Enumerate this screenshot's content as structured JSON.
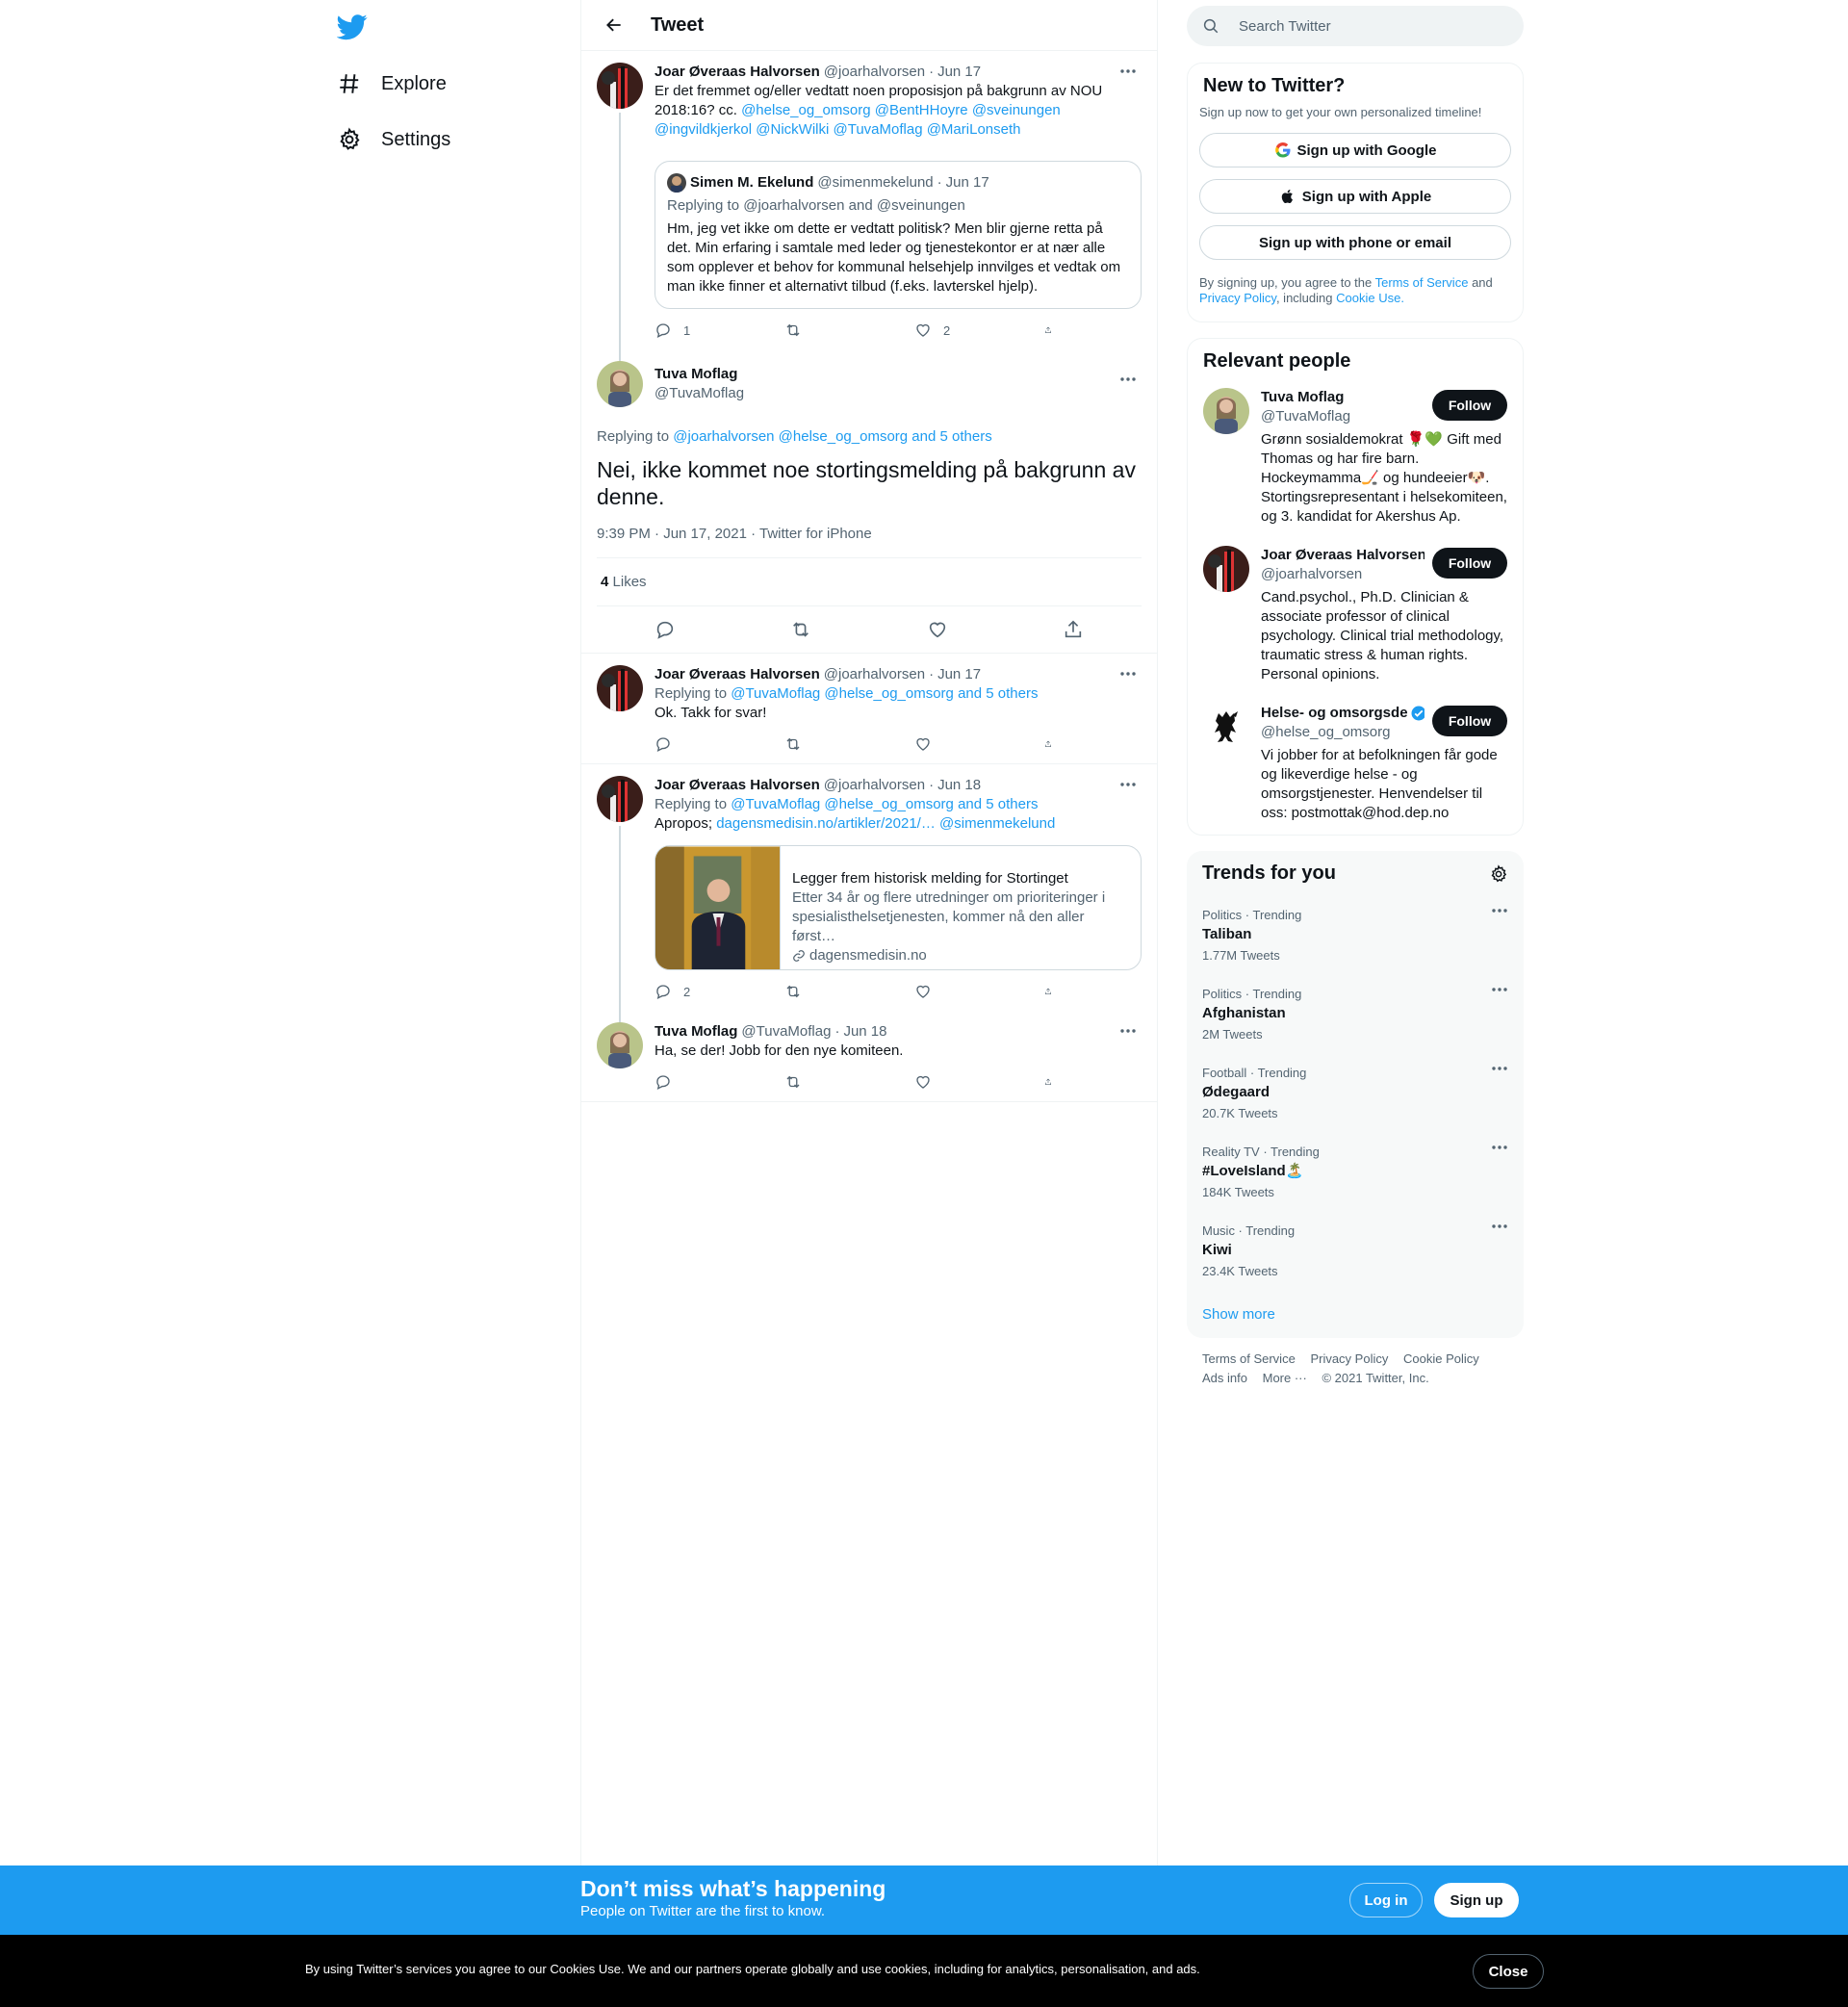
{
  "nav": {
    "items": [
      {
        "label": "Explore",
        "icon": "hashtag-icon"
      },
      {
        "label": "Settings",
        "icon": "gear-icon"
      }
    ]
  },
  "header": {
    "title": "Tweet"
  },
  "parent_tweet": {
    "name": "Joar Øveraas Halvorsen",
    "handle": "@joarhalvorsen",
    "date": "Jun 17",
    "text_plain": "Er det fremmet og/eller vedtatt noen proposisjon på bakgrunn av NOU 2018:16? cc.",
    "mentions_1": "@helse_og_omsorg @BentHHoyre @sveinungen @ingvildkjerkol",
    "mentions_2": "@NickWilki @TuvaMoflag @MariLonseth",
    "quote": {
      "name": "Simen M. Ekelund",
      "handle": "@simenmekelund",
      "date": "Jun 17",
      "replying": "Replying to @joarhalvorsen and @sveinungen",
      "text": "Hm, jeg vet ikke om dette er vedtatt politisk? Men blir gjerne retta på det. Min erfaring i samtale med leder og tjenestekontor er at nær alle som opplever et behov for kommunal helsehjelp innvilges et vedtak om man ikke finner et alternativt tilbud (f.eks. lavterskel hjelp)."
    },
    "replies": "1",
    "retweets": "",
    "likes": "2"
  },
  "focal_tweet": {
    "name": "Tuva Moflag",
    "handle": "@TuvaMoflag",
    "replying_prefix": "Replying to",
    "replying_links": "@joarhalvorsen @helse_og_omsorg and 5 others",
    "text": "Nei, ikke kommet noe stortingsmelding på bakgrunn av denne.",
    "timestamp": "9:39 PM · Jun 17, 2021 · Twitter for iPhone",
    "likes_count": "4",
    "likes_label": "Likes"
  },
  "replies": [
    {
      "name": "Joar Øveraas Halvorsen",
      "handle": "@joarhalvorsen",
      "date": "Jun 17",
      "replying_prefix": "Replying to",
      "replying_links": "@TuvaMoflag @helse_og_omsorg and 5 others",
      "text": "Ok. Takk for svar!",
      "replies": ""
    },
    {
      "name": "Joar Øveraas Halvorsen",
      "handle": "@joarhalvorsen",
      "date": "Jun 18",
      "replying_prefix": "Replying to",
      "replying_links": "@TuvaMoflag @helse_og_omsorg and 5 others",
      "text_prefix": "Apropos;",
      "link": "dagensmedisin.no/artikler/2021/…",
      "mention": "@simenmekelund",
      "card": {
        "title": "Legger frem historisk melding for Stortinget",
        "description": "Etter 34 år og flere utredninger om prioriteringer i spesialisthelsetjenesten, kommer nå den aller først…",
        "site": "dagensmedisin.no"
      },
      "replies": "2"
    },
    {
      "name": "Tuva Moflag",
      "handle": "@TuvaMoflag",
      "date": "Jun 18",
      "text": "Ha, se der! Jobb for den nye komiteen.",
      "replies": ""
    }
  ],
  "search": {
    "placeholder": "Search Twitter"
  },
  "signup_panel": {
    "title": "New to Twitter?",
    "subtitle": "Sign up now to get your own personalized timeline!",
    "google": "Sign up with Google",
    "apple": "Sign up with Apple",
    "phone": "Sign up with phone or email",
    "legal_1": "By signing up, you agree to the",
    "terms": "Terms of Service",
    "legal_and": "and",
    "privacy": "Privacy Policy",
    "legal_including": ", including",
    "cookie": "Cookie Use."
  },
  "relevant_people": {
    "title": "Relevant people",
    "follow_label": "Follow",
    "people": [
      {
        "name": "Tuva Moflag",
        "handle": "@TuvaMoflag",
        "bio": "Grønn sosialdemokrat 🌹💚 Gift med Thomas og har fire barn. Hockeymamma🏒 og hundeeier🐶. Stortingsrepresentant i helsekomiteen, og 3. kandidat for Akershus Ap."
      },
      {
        "name": "Joar Øveraas Halvorsen",
        "handle": "@joarhalvorsen",
        "bio": "Cand.psychol., Ph.D. Clinician & associate professor of clinical psychology. Clinical trial methodology, traumatic stress & human rights. Personal opinions."
      },
      {
        "name": "Helse- og omsorgsde",
        "handle": "@helse_og_omsorg",
        "bio": "Vi jobber for at befolkningen får gode og likeverdige helse - og omsorgstjenester. Henvendelser til oss: postmottak@hod.dep.no"
      }
    ]
  },
  "trends": {
    "title": "Trends for you",
    "items": [
      {
        "context": "Politics · Trending",
        "name": "Taliban",
        "count": "1.77M Tweets"
      },
      {
        "context": "Politics · Trending",
        "name": "Afghanistan",
        "count": "2M Tweets"
      },
      {
        "context": "Football · Trending",
        "name": "Ødegaard",
        "count": "20.7K Tweets"
      },
      {
        "context": "Reality TV · Trending",
        "name": "#LoveIsland🏝️",
        "count": "184K Tweets"
      },
      {
        "context": "Music · Trending",
        "name": "Kiwi",
        "count": "23.4K Tweets"
      }
    ],
    "show_more": "Show more"
  },
  "footer": {
    "terms": "Terms of Service",
    "privacy": "Privacy Policy",
    "cookie": "Cookie Policy",
    "ads": "Ads info",
    "more": "More ···",
    "copyright": "© 2021 Twitter, Inc."
  },
  "banner": {
    "title": "Don’t miss what’s happening",
    "subtitle": "People on Twitter are the first to know.",
    "login": "Log in",
    "signup": "Sign up"
  },
  "cookie_bar": {
    "text": "By using Twitter’s services you agree to our Cookies Use. We and our partners operate globally and use cookies, including for analytics, personalisation, and ads.",
    "close": "Close"
  },
  "colors": {
    "accent": "#1d9bf0",
    "text": "#0f1419",
    "secondary": "#536471",
    "border": "#eff3f4"
  }
}
